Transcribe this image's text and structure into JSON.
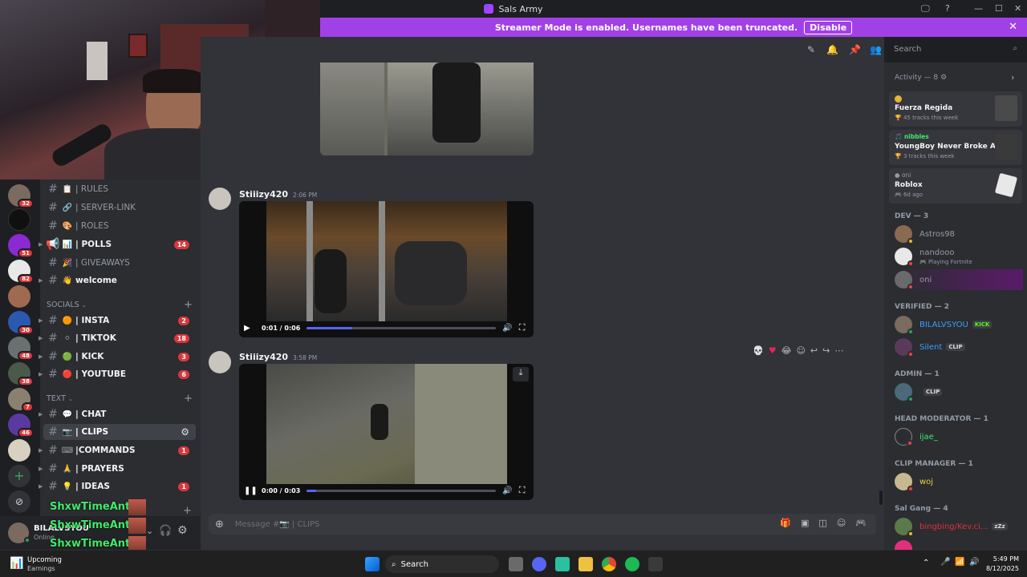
{
  "window": {
    "title": "Sals Army",
    "controls": [
      "🖵",
      "?",
      "—",
      "☐",
      "✕"
    ]
  },
  "banner": {
    "text": "Streamer Mode is enabled. Usernames have been truncated.",
    "button": "Disable",
    "close": "✕"
  },
  "server_badges": [
    "32",
    "51",
    "82",
    "30",
    "48",
    "38",
    "7",
    "46"
  ],
  "channels": {
    "items": [
      {
        "emoji": "📋",
        "name": "| RULES"
      },
      {
        "emoji": "🔗",
        "name": "| SERVER-LINK"
      },
      {
        "emoji": "🎨",
        "name": "| ROLES"
      },
      {
        "emoji": "📊",
        "name": "| POLLS",
        "count": "14"
      },
      {
        "emoji": "🎉",
        "name": "| GIVEAWAYS"
      },
      {
        "emoji": "👋",
        "name": "welcome"
      }
    ],
    "socials_label": "SOCIALS",
    "socials": [
      {
        "emoji": "🟠",
        "name": "| INSTA",
        "count": "2"
      },
      {
        "emoji": "⚪",
        "name": "| TIKTOK",
        "count": "18"
      },
      {
        "emoji": "🟢",
        "name": "| KICK",
        "count": "3"
      },
      {
        "emoji": "🔴",
        "name": "| YOUTUBE",
        "count": "6"
      }
    ],
    "text_label": "TEXT",
    "text": [
      {
        "emoji": "💬",
        "name": "| CHAT"
      },
      {
        "emoji": "📷",
        "name": "| CLIPS"
      },
      {
        "emoji": "⌨",
        "name": "|COMMANDS",
        "count": "1"
      },
      {
        "emoji": "🙏",
        "name": "| PRAYERS"
      },
      {
        "emoji": "💡",
        "name": "| IDEAS",
        "count": "1"
      }
    ]
  },
  "overlay_name": "ShxwTimeAnt",
  "user": {
    "name": "BILALVSYOU",
    "status": "Online"
  },
  "messages": [
    {
      "author": "Stiiizy420",
      "time": "2:06 PM",
      "video_time": "0:01 / 0:06",
      "progress": 0.24
    },
    {
      "author": "Stiiizy420",
      "time": "3:58 PM",
      "video_time": "0:00 / 0:03",
      "progress": 0.05
    }
  ],
  "message_placeholder": "Message #📷 | CLIPS",
  "search_placeholder": "Search",
  "activity": {
    "header": "Activity — 8",
    "cards": [
      {
        "line1": "",
        "title": "Fuerza Regida",
        "sub": "45 tracks this week"
      },
      {
        "line1": "nibbles",
        "title": "YoungBoy Never Broke Again",
        "sub": "3 tracks this week"
      },
      {
        "line1": "oni",
        "title": "Roblox",
        "sub": "6d ago"
      }
    ]
  },
  "member_groups": [
    {
      "label": "DEV — 3",
      "members": [
        {
          "name": "Astros98"
        },
        {
          "name": "nandooo",
          "sub": "Playing Fortnite"
        },
        {
          "name": "oni"
        }
      ]
    },
    {
      "label": "VERIFIED — 2",
      "members": [
        {
          "name": "BILALVSYOU",
          "tag": "KICK"
        },
        {
          "name": "Silent",
          "tag": "CLIP"
        }
      ]
    },
    {
      "label": "ADMIN — 1",
      "members": [
        {
          "name": "",
          "tag": "CLIP"
        }
      ]
    },
    {
      "label": "HEAD MODERATOR — 1",
      "members": [
        {
          "name": "ijae_"
        }
      ]
    },
    {
      "label": "CLIP MANAGER — 1",
      "members": [
        {
          "name": "woj"
        }
      ]
    },
    {
      "label": "Sal Gang — 4",
      "members": [
        {
          "name": "bingbing/Kev.ci...",
          "tag": "zZz"
        }
      ]
    }
  ],
  "taskbar": {
    "weather_title": "Upcoming",
    "weather_sub": "Earnings",
    "search": "Search",
    "time": "5:49 PM",
    "date": "8/12/2025"
  },
  "colors": {
    "accent": "#5865f2",
    "banner": "#a240e8",
    "mention": "#da373c"
  }
}
